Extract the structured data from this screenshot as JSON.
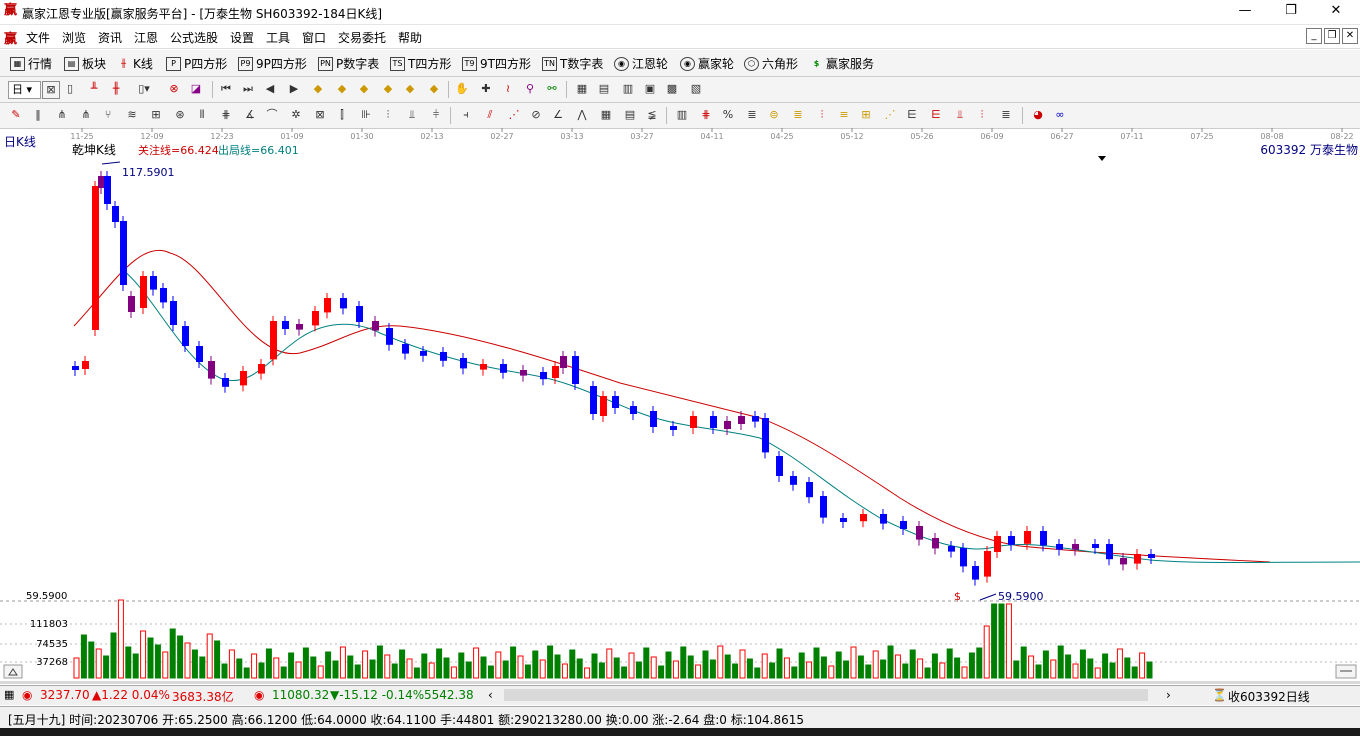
{
  "window": {
    "title": "赢家江恩专业版[赢家服务平台] - [万泰生物   SH603392-184日K线]",
    "minimize": "—",
    "maximize": "❐",
    "close": "✕"
  },
  "menu": [
    "文件",
    "浏览",
    "资讯",
    "江恩",
    "公式选股",
    "设置",
    "工具",
    "窗口",
    "交易委托",
    "帮助"
  ],
  "nav": [
    {
      "label": "行情",
      "icon": "grid-icon"
    },
    {
      "label": "板块",
      "icon": "block-icon"
    },
    {
      "label": "K线",
      "icon": "kline-icon"
    },
    {
      "label": "P四方形",
      "icon": "P"
    },
    {
      "label": "9P四方形",
      "icon": "P9"
    },
    {
      "label": "P数字表",
      "icon": "PN"
    },
    {
      "label": "T四方形",
      "icon": "TS"
    },
    {
      "label": "9T四方形",
      "icon": "T9"
    },
    {
      "label": "T数字表",
      "icon": "TN"
    },
    {
      "label": "江恩轮",
      "icon": "wheel-icon"
    },
    {
      "label": "赢家轮",
      "icon": "wheel-icon"
    },
    {
      "label": "六角形",
      "icon": "hexagon-icon"
    },
    {
      "label": "赢家服务",
      "icon": "$"
    }
  ],
  "toolbar1": {
    "period": "日",
    "pct": "%"
  },
  "chart": {
    "period_label": "日K线",
    "indicator_name": "乾坤K线",
    "guanzhu": "关注线=66.424",
    "chuju": "出局线=66.401",
    "stock": "603392 万泰生物",
    "high_label": "117.5901",
    "low_label": "59.5900",
    "dollar": "$",
    "vol_price_label": "59.5900",
    "vol_ticks": [
      "111803",
      "74535",
      "37268"
    ],
    "date_ticks": [
      "11-25",
      "12-09",
      "12-23",
      "01-09",
      "01-30",
      "02-13",
      "02-27",
      "03-13",
      "03-27",
      "04-11",
      "04-25",
      "05-12",
      "05-26",
      "06-09",
      "06-27",
      "07-11",
      "07-25",
      "08-08",
      "08-22"
    ],
    "colors": {
      "up": "#ff0000",
      "down": "#0000ff",
      "purple": "#800080",
      "ma1": "#cc0000",
      "ma2": "#008080",
      "volup": "#ff0000",
      "voldown": "#008000"
    }
  },
  "chart_data": {
    "type": "candlestick",
    "title": "乾坤K线",
    "ylim": [
      59.59,
      117.59
    ],
    "high": 117.5901,
    "low": 59.59,
    "series": [
      {
        "name": "关注线",
        "last": 66.424
      },
      {
        "name": "出局线",
        "last": 66.401
      }
    ]
  },
  "status": {
    "sh_index": "3237.70",
    "sh_change": "▲1.22 0.04%",
    "sh_amount": "3683.38亿",
    "sz_index": "11080.32",
    "sz_change": "▼-15.12 -0.14%",
    "sz_amount": "5542.38",
    "collect": "收603392日线"
  },
  "info": {
    "text": "[五月十九] 时间:20230706 开:65.2500 高:66.1200 低:64.0000 收:64.1100 手:44801 额:290213280.00 换:0.00 涨:-2.64 盘:0 标:104.8615"
  }
}
